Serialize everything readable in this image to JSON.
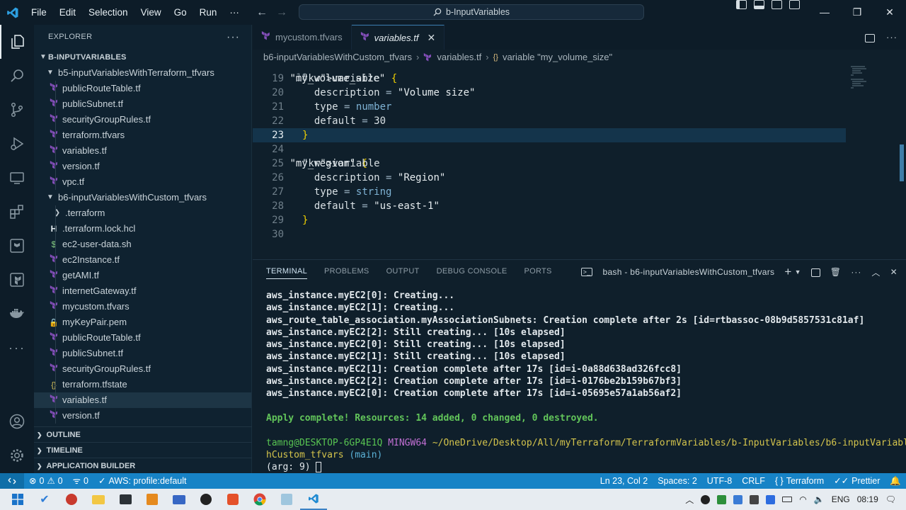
{
  "titlebar": {
    "menu": [
      "File",
      "Edit",
      "Selection",
      "View",
      "Go",
      "Run",
      "···"
    ],
    "search_text": "b-InputVariables"
  },
  "explorer": {
    "header": "EXPLORER",
    "root": "B-INPUTVARIABLES",
    "tree": [
      {
        "label": "b5-inputVariablesWithTerraform_tfvars",
        "type": "folder-open",
        "depth": 1
      },
      {
        "label": "publicRouteTable.tf",
        "type": "tf",
        "depth": 2
      },
      {
        "label": "publicSubnet.tf",
        "type": "tf",
        "depth": 2
      },
      {
        "label": "securityGroupRules.tf",
        "type": "tf",
        "depth": 2
      },
      {
        "label": "terraform.tfvars",
        "type": "tf",
        "depth": 2
      },
      {
        "label": "variables.tf",
        "type": "tf",
        "depth": 2
      },
      {
        "label": "version.tf",
        "type": "tf",
        "depth": 2
      },
      {
        "label": "vpc.tf",
        "type": "tf",
        "depth": 2
      },
      {
        "label": "b6-inputVariablesWithCustom_tfvars",
        "type": "folder-open",
        "depth": 1
      },
      {
        "label": ".terraform",
        "type": "folder-closed",
        "depth": 2
      },
      {
        "label": ".terraform.lock.hcl",
        "type": "hcl",
        "depth": 2
      },
      {
        "label": "ec2-user-data.sh",
        "type": "sh",
        "depth": 2
      },
      {
        "label": "ec2Instance.tf",
        "type": "tf",
        "depth": 2
      },
      {
        "label": "getAMI.tf",
        "type": "tf",
        "depth": 2
      },
      {
        "label": "internetGateway.tf",
        "type": "tf",
        "depth": 2
      },
      {
        "label": "mycustom.tfvars",
        "type": "tf",
        "depth": 2
      },
      {
        "label": "myKeyPair.pem",
        "type": "pem",
        "depth": 2
      },
      {
        "label": "publicRouteTable.tf",
        "type": "tf",
        "depth": 2
      },
      {
        "label": "publicSubnet.tf",
        "type": "tf",
        "depth": 2
      },
      {
        "label": "securityGroupRules.tf",
        "type": "tf",
        "depth": 2
      },
      {
        "label": "terraform.tfstate",
        "type": "json",
        "depth": 2
      },
      {
        "label": "variables.tf",
        "type": "tf",
        "depth": 2,
        "selected": true
      },
      {
        "label": "version.tf",
        "type": "tf",
        "depth": 2
      }
    ],
    "sections": [
      "OUTLINE",
      "TIMELINE",
      "APPLICATION BUILDER"
    ]
  },
  "tabs": [
    {
      "label": "mycustom.tfvars",
      "active": false
    },
    {
      "label": "variables.tf",
      "active": true
    }
  ],
  "breadcrumb": [
    "b6-inputVariablesWithCustom_tfvars",
    "variables.tf",
    "variable \"my_volume_size\""
  ],
  "code": {
    "top_partial_line": "18",
    "lines": [
      {
        "n": "19",
        "text": "variable \"my_volume_size\" {"
      },
      {
        "n": "20",
        "text": "  description = \"Volume size\""
      },
      {
        "n": "21",
        "text": "  type = number"
      },
      {
        "n": "22",
        "text": "  default = 30"
      },
      {
        "n": "23",
        "text": "}",
        "current": true
      },
      {
        "n": "24",
        "text": ""
      },
      {
        "n": "25",
        "text": "variable \"my_region\" {"
      },
      {
        "n": "26",
        "text": "  description = \"Region\""
      },
      {
        "n": "27",
        "text": "  type = string"
      },
      {
        "n": "28",
        "text": "  default = \"us-east-1\""
      },
      {
        "n": "29",
        "text": "}"
      },
      {
        "n": "30",
        "text": ""
      }
    ]
  },
  "terminal": {
    "tabs": [
      "TERMINAL",
      "PROBLEMS",
      "OUTPUT",
      "DEBUG CONSOLE",
      "PORTS"
    ],
    "shell_label": "bash - b6-inputVariablesWithCustom_tfvars",
    "lines": [
      "aws_instance.myEC2[0]: Creating...",
      "aws_instance.myEC2[1]: Creating...",
      "aws_route_table_association.myAssociationSubnets: Creation complete after 2s [id=rtbassoc-08b9d5857531c81af]",
      "aws_instance.myEC2[2]: Still creating... [10s elapsed]",
      "aws_instance.myEC2[0]: Still creating... [10s elapsed]",
      "aws_instance.myEC2[1]: Still creating... [10s elapsed]",
      "aws_instance.myEC2[1]: Creation complete after 17s [id=i-0a88d638ad326fcc8]",
      "aws_instance.myEC2[2]: Creation complete after 17s [id=i-0176be2b159b67bf3]",
      "aws_instance.myEC2[0]: Creation complete after 17s [id=i-05695e57a1ab56af2]"
    ],
    "apply_complete": "Apply complete! Resources: 14 added, 0 changed, 0 destroyed.",
    "prompt_user": "tamng@DESKTOP-6GP4E1Q",
    "prompt_env": "MINGW64",
    "prompt_path_1": "~/OneDrive/Desktop/All/myTerraform/TerraformVariables/b-InputVariables/b6-inputVariablesWit",
    "prompt_path_2": "hCustom_tfvars",
    "prompt_branch": "(main)",
    "arg_line": "(arg: 9)"
  },
  "statusbar": {
    "errors": "0",
    "warnings": "0",
    "info": "0",
    "aws_profile": "AWS: profile:default",
    "position": "Ln 23, Col 2",
    "spaces": "Spaces: 2",
    "encoding": "UTF-8",
    "eol": "CRLF",
    "language": "Terraform",
    "formatter": "Prettier"
  },
  "taskbar": {
    "lang": "ENG",
    "time": "08:19"
  },
  "colors": {
    "accent": "#1783c6",
    "terraform": "#844fba",
    "apply_green": "#62c55a"
  }
}
